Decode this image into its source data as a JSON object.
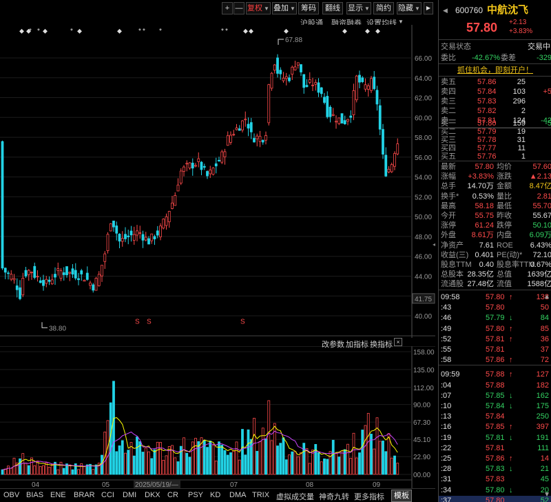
{
  "toolbar": {
    "plus": "+",
    "minus": "—",
    "fuquan": "复权",
    "diejia": "叠加",
    "chouma": "筹码",
    "fanxian": "翻线",
    "xianshi": "显示",
    "jianyue": "简约",
    "yincang": "隐藏"
  },
  "subbar": {
    "hugutong": "沪股通",
    "rongzi": "融资融券",
    "junxian": "设置均线"
  },
  "chart": {
    "price_ticks": [
      "66.00",
      "64.00",
      "62.00",
      "60.00",
      "58.00",
      "56.00",
      "54.00",
      "52.00",
      "50.00",
      "48.00",
      "46.00",
      "44.00",
      "42.00",
      "40.00"
    ],
    "current_price_label": "41.75",
    "max_label": "67.88",
    "min_label": "38.80",
    "volume_ticks": [
      "158.00",
      "135.00",
      "112.00",
      "90.00",
      "67.30",
      "45.10",
      "22.90",
      "00.00"
    ],
    "x_labels": [
      "04",
      "05",
      "2025/05/19/—",
      "07",
      "08",
      "09"
    ],
    "vol_toolbar": {
      "gai": "改参数",
      "jia": "加指标",
      "huan": "换指标"
    }
  },
  "indicators": [
    "OBV",
    "BIAS",
    "ENE",
    "BRAR",
    "CCI",
    "DMI",
    "DKX",
    "CR",
    "PSY",
    "KD",
    "DMA",
    "TRIX",
    "虚拟成交量",
    "神奇九转",
    "更多指标",
    "模板"
  ],
  "stock": {
    "code": "600760",
    "name": "中航沈飞",
    "price": "57.80",
    "change": "+2.13",
    "pct": "+3.83%",
    "status_label": "交易状态",
    "status_value": "交易中",
    "weibi_label": "委比",
    "weibi_value": "-42.67%",
    "weicha_label": "委差",
    "weicha_value": "-329",
    "promo": "抓住机会，即刻开户！"
  },
  "order_book": {
    "asks": [
      {
        "label": "卖五",
        "price": "57.86",
        "vol": "25",
        "chg": ""
      },
      {
        "label": "卖四",
        "price": "57.84",
        "vol": "103",
        "chg": "+5"
      },
      {
        "label": "卖三",
        "price": "57.83",
        "vol": "296",
        "chg": ""
      },
      {
        "label": "卖二",
        "price": "57.82",
        "vol": "2",
        "chg": ""
      },
      {
        "label": "卖一",
        "price": "57.81",
        "vol": "124",
        "chg": "-42"
      }
    ],
    "bids": [
      {
        "label": "买一",
        "price": "57.80",
        "vol": "159",
        "chg": "-5"
      },
      {
        "label": "买二",
        "price": "57.79",
        "vol": "19",
        "chg": ""
      },
      {
        "label": "买三",
        "price": "57.78",
        "vol": "31",
        "chg": ""
      },
      {
        "label": "买四",
        "price": "57.77",
        "vol": "11",
        "chg": ""
      },
      {
        "label": "买五",
        "price": "57.76",
        "vol": "1",
        "chg": ""
      }
    ]
  },
  "quote": [
    {
      "l1": "最新",
      "v1": "57.80",
      "c1": "red",
      "l2": "均价",
      "v2": "57.60",
      "c2": "red"
    },
    {
      "l1": "涨幅",
      "v1": "+3.83%",
      "c1": "red",
      "l2": "涨跌",
      "v2": "▲2.13",
      "c2": "red"
    },
    {
      "l1": "总手",
      "v1": "14.70万",
      "c1": "white",
      "l2": "金额",
      "v2": "8.47亿",
      "c2": "yellow"
    },
    {
      "l1": "换手*",
      "v1": "0.53%",
      "c1": "white",
      "l2": "量比",
      "v2": "2.81",
      "c2": "red"
    },
    {
      "l1": "最高",
      "v1": "58.18",
      "c1": "red",
      "l2": "最低",
      "v2": "55.70",
      "c2": "red"
    },
    {
      "l1": "今开",
      "v1": "55.75",
      "c1": "red",
      "l2": "昨收",
      "v2": "55.67",
      "c2": "white"
    },
    {
      "l1": "涨停",
      "v1": "61.24",
      "c1": "red",
      "l2": "跌停",
      "v2": "50.10",
      "c2": "green"
    },
    {
      "l1": "外盘",
      "v1": "8.61万",
      "c1": "red",
      "l2": "内盘",
      "v2": "6.09万",
      "c2": "green"
    },
    {
      "l1": "净资产",
      "v1": "7.61",
      "c1": "white",
      "l2": "ROE",
      "v2": "6.43%",
      "c2": "white"
    },
    {
      "l1": "收益(三)",
      "v1": "0.401",
      "c1": "white",
      "l2": "PE(动)*",
      "v2": "72.10",
      "c2": "white"
    },
    {
      "l1": "股息TTM",
      "v1": "0.40",
      "c1": "white",
      "l2": "股息率TTM",
      "v2": "0.67%",
      "c2": "white"
    },
    {
      "l1": "总股本",
      "v1": "28.35亿",
      "c1": "white",
      "l2": "总值",
      "v2": "1639亿",
      "c2": "white"
    },
    {
      "l1": "流通股",
      "v1": "27.48亿",
      "c1": "white",
      "l2": "流值",
      "v2": "1588亿",
      "c2": "white"
    }
  ],
  "ticks": [
    {
      "t": "09:58",
      "p": "57.80",
      "a": "↑",
      "v": "138",
      "pc": "red",
      "vc": "red"
    },
    {
      "t": ":43",
      "p": "57.80",
      "a": "",
      "v": "50",
      "pc": "red",
      "vc": "red"
    },
    {
      "t": ":46",
      "p": "57.79",
      "a": "↓",
      "v": "84",
      "pc": "green",
      "vc": "green"
    },
    {
      "t": ":49",
      "p": "57.80",
      "a": "↑",
      "v": "85",
      "pc": "red",
      "vc": "red"
    },
    {
      "t": ":52",
      "p": "57.81",
      "a": "↑",
      "v": "36",
      "pc": "red",
      "vc": "red"
    },
    {
      "t": ":55",
      "p": "57.81",
      "a": "",
      "v": "37",
      "pc": "red",
      "vc": "red"
    },
    {
      "t": ":58",
      "p": "57.86",
      "a": "↑",
      "v": "72",
      "pc": "red",
      "vc": "red"
    },
    {
      "t": "09:59",
      "p": "57.88",
      "a": "↑",
      "v": "127",
      "pc": "red",
      "vc": "red"
    },
    {
      "t": ":04",
      "p": "57.88",
      "a": "",
      "v": "182",
      "pc": "red",
      "vc": "red"
    },
    {
      "t": ":07",
      "p": "57.85",
      "a": "↓",
      "v": "162",
      "pc": "green",
      "vc": "green"
    },
    {
      "t": ":10",
      "p": "57.84",
      "a": "↓",
      "v": "175",
      "pc": "green",
      "vc": "green"
    },
    {
      "t": ":13",
      "p": "57.84",
      "a": "",
      "v": "250",
      "pc": "red",
      "vc": "green"
    },
    {
      "t": ":16",
      "p": "57.85",
      "a": "↑",
      "v": "397",
      "pc": "red",
      "vc": "red"
    },
    {
      "t": ":19",
      "p": "57.81",
      "a": "↓",
      "v": "191",
      "pc": "green",
      "vc": "green"
    },
    {
      "t": ":22",
      "p": "57.81",
      "a": "",
      "v": "111",
      "pc": "red",
      "vc": "green"
    },
    {
      "t": ":25",
      "p": "57.86",
      "a": "↑",
      "v": "14",
      "pc": "red",
      "vc": "red"
    },
    {
      "t": ":28",
      "p": "57.83",
      "a": "↓",
      "v": "21",
      "pc": "green",
      "vc": "green"
    },
    {
      "t": ":31",
      "p": "57.83",
      "a": "",
      "v": "45",
      "pc": "red",
      "vc": "green"
    },
    {
      "t": ":34",
      "p": "57.80",
      "a": "↓",
      "v": "20",
      "pc": "green",
      "vc": "green"
    },
    {
      "t": ":37",
      "p": "57.80",
      "a": "",
      "v": "52",
      "pc": "red",
      "vc": "green"
    }
  ],
  "colors": {
    "up": "#ff4b4b",
    "down": "#22d3e6",
    "ma5": "#ffff00",
    "ma10": "#cc44ff",
    "accent": "#ff4040"
  }
}
